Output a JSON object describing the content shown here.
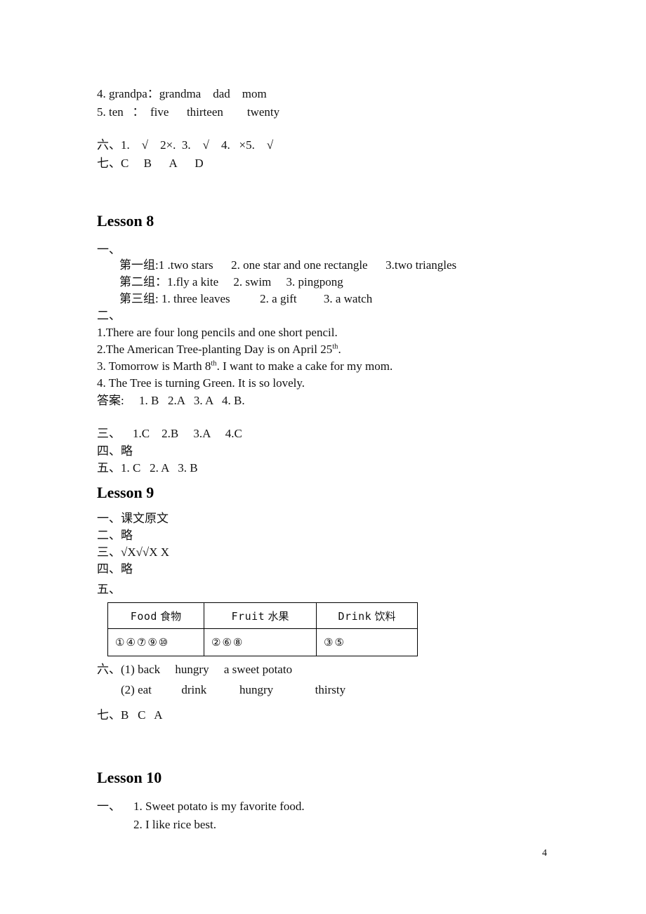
{
  "page": {
    "number": "4",
    "background_color": "#ffffff",
    "text_color": "#111111"
  },
  "top_section": {
    "line_4": "4. grandpa：grandma    dad    mom",
    "line_5": "5. ten   ：  five      thirteen        twenty",
    "line_6": "六、1.    √    2×.  3.    √    4.   ×5.    √",
    "line_7": "七、C     B      A      D"
  },
  "lesson8": {
    "title": "Lesson 8",
    "section1_label": "一、",
    "group1": "第一组:1 .two stars      2. one star and one rectangle      3.two triangles",
    "group2": "第二组：1.fly a kite     2. swim     3. pingpong",
    "group3": "第三组: 1. three leaves          2. a gift         3. a watch",
    "section2_label": "二、",
    "sent1": "1.There are four long pencils and one short pencil.",
    "sent2_pre": "2.The American Tree-planting Day is on April 25",
    "sent2_sup": "th",
    "sent2_post": ".",
    "sent3_pre": "3. Tomorrow is Marth 8",
    "sent3_sup": "th",
    "sent3_post": ". I want to make a cake for my mom.",
    "sent4": "4. The Tree is turning Green. It is so lovely.",
    "answers": "答案:     1. B   2.A   3. A   4. B.",
    "section3": "三、    1.C    2.B     3.A     4.C",
    "section4": "四、略",
    "section5": "五、1. C   2. A   3. B"
  },
  "lesson9": {
    "title": "Lesson 9",
    "section1": "一、课文原文",
    "section2": "二、略",
    "section3": "三、√X√√X X",
    "section4": "四、略",
    "section5_label": "五、",
    "table": {
      "headers": [
        {
          "en": "Food",
          "cn": "食物"
        },
        {
          "en": "Fruit",
          "cn": "水果"
        },
        {
          "en": "Drink",
          "cn": "饮料"
        }
      ],
      "row": [
        "①④⑦⑨⑩",
        "②⑥⑧",
        "③⑤"
      ]
    },
    "section6_line1": "六、(1) back     hungry     a sweet potato",
    "section6_line2": "(2) eat          drink           hungry              thirsty",
    "section7": "七、B   C   A"
  },
  "lesson10": {
    "title": "Lesson 10",
    "section1_label": "一、",
    "item1": "1. Sweet potato is my favorite food.",
    "item2": "2. I like rice best."
  }
}
